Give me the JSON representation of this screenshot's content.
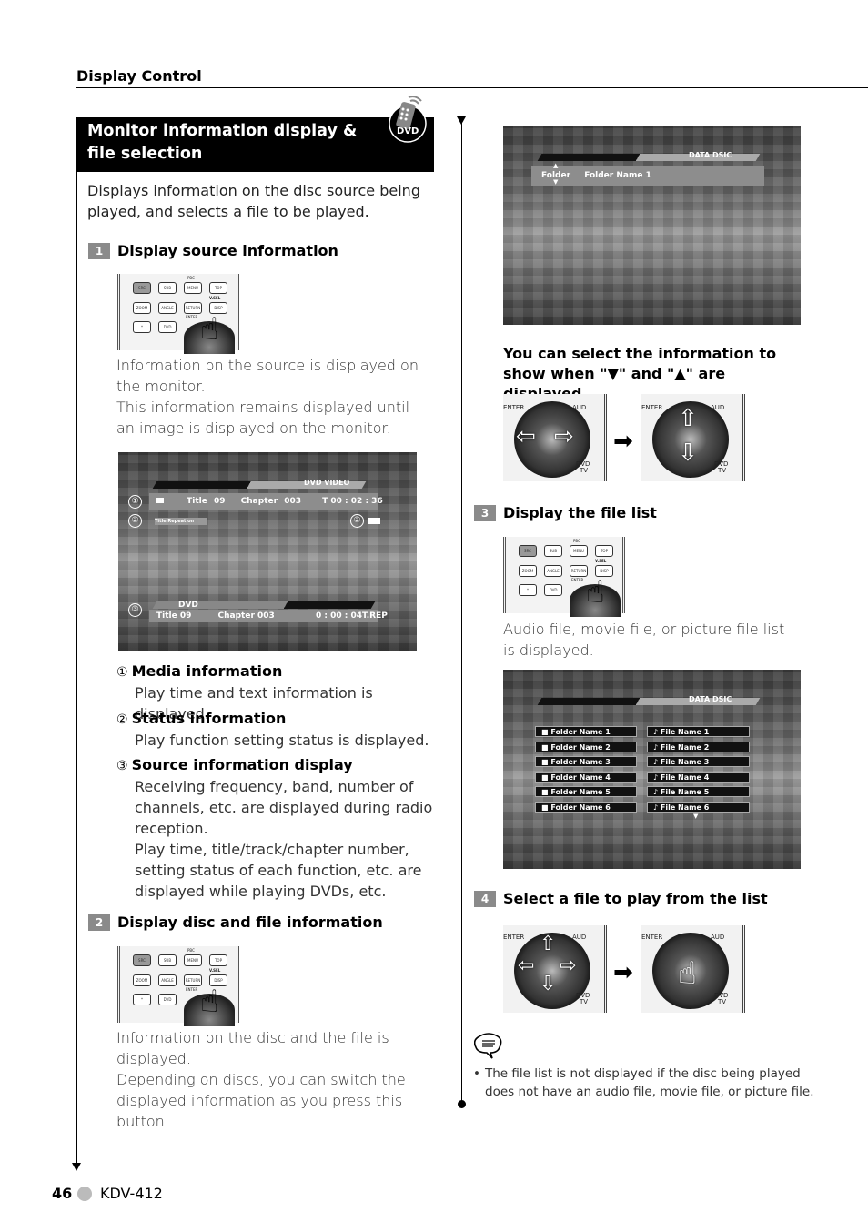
{
  "header": {
    "section_title": "Display Control"
  },
  "main_heading": {
    "line1": "Monitor information display &",
    "line2": "file selection",
    "badge": "DVD",
    "badge_icon": "remote-control-icon"
  },
  "intro": "Displays information on the disc source being played, and selects a file to be played.",
  "remote_buttons": {
    "src": "SRC",
    "subtitle": "SUB TITLE",
    "menu": "MENU",
    "topmenu": "TOP MENU",
    "zoom": "ZOOM",
    "angle": "ANGLE",
    "return": "RETURN",
    "disp": "DISP",
    "pbc": "PBC",
    "vsel": "V.SEL",
    "enter": "ENTER",
    "star": "*",
    "dvdsetup": "DVD SETUP"
  },
  "steps": [
    {
      "number": "1",
      "title": "Display source information",
      "description_lines": [
        "Information on the source is displayed on the monitor.",
        "This information remains displayed until an image is displayed on the monitor."
      ]
    },
    {
      "number": "2",
      "title": "Display disc and file information",
      "description_lines": [
        "Information on the disc and the file is displayed.",
        "Depending on discs, you can switch the displayed information as you press this button."
      ]
    },
    {
      "number": "3",
      "title": "Display the file list",
      "description_lines": [
        "Audio file, movie file, or picture file list is displayed."
      ]
    },
    {
      "number": "4",
      "title": "Select a file to play from the list"
    }
  ],
  "dvd_screen": {
    "source_label": "DVD VIDEO",
    "media_info": {
      "title_label": "Title",
      "title_value": "09",
      "chapter_label": "Chapter",
      "chapter_value": "003",
      "time": "T  00 : 02 : 36"
    },
    "status": "Title Repeat on",
    "markers": [
      "①",
      "②",
      "②",
      "③"
    ],
    "source_bar": {
      "label": "DVD",
      "title": "Title    09",
      "chapter": "Chapter 003",
      "time": "0 : 00 : 04T.REP"
    }
  },
  "legend": [
    {
      "mark": "①",
      "title": "Media information",
      "lines": [
        "Play time and text information is displayed."
      ]
    },
    {
      "mark": "②",
      "title": "Status information",
      "lines": [
        "Play function setting status is displayed."
      ]
    },
    {
      "mark": "③",
      "title": "Source information display",
      "lines": [
        "Receiving frequency, band, number of channels, etc. are displayed during radio reception.",
        "Play time, title/track/chapter number, setting status of  each function, etc. are displayed while playing DVDs, etc."
      ]
    }
  ],
  "data_screen": {
    "source_label": "DATA DSIC",
    "folder_label": "Folder",
    "folder_value": "Folder Name 1"
  },
  "select_info": "You can select the information to show when \"▼\" and \"▲\" are displayed.",
  "dpad_labels": {
    "enter": "ENTER",
    "aud": "AUD",
    "dvd": "DVD",
    "tv": "TV"
  },
  "file_list_screen": {
    "source_label": "DATA DSIC",
    "folders": [
      "Folder Name 1",
      "Folder Name 2",
      "Folder Name 3",
      "Folder Name 4",
      "Folder Name 5",
      "Folder Name 6"
    ],
    "files": [
      "File Name 1",
      "File Name 2",
      "File Name 3",
      "File Name 4",
      "File Name 5",
      "File Name 6"
    ]
  },
  "note": {
    "icon": "note-speech-bubble-icon",
    "bullet": "The file list is not displayed if the disc being played does not have an audio file, movie file, or picture file."
  },
  "footer": {
    "page_number": "46",
    "model": "KDV-412"
  }
}
